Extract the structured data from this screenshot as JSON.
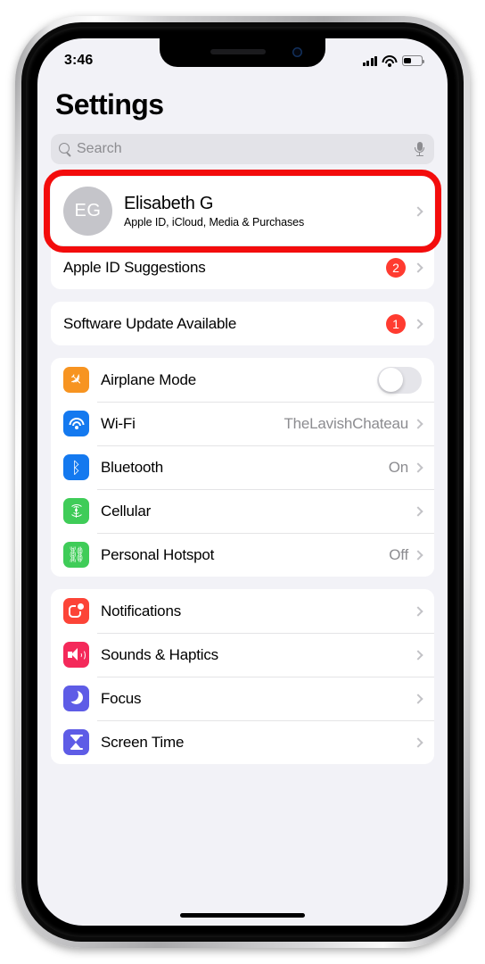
{
  "status_bar": {
    "time": "3:46",
    "signal_icon": "cellular-bars-icon",
    "wifi_icon": "wifi-icon",
    "battery_icon": "battery-icon",
    "battery_level_percent": 35
  },
  "header": {
    "title": "Settings"
  },
  "search": {
    "placeholder": "Search",
    "search_icon": "search-icon",
    "dictation_icon": "microphone-icon"
  },
  "apple_id": {
    "avatar_initials": "EG",
    "name": "Elisabeth G",
    "subtitle": "Apple ID, iCloud, Media & Purchases",
    "highlighted": true,
    "highlight_color": "#f30c0c"
  },
  "groups": [
    {
      "id": "account-group",
      "rows": [
        {
          "name": "apple-id-suggestions",
          "label": "Apple ID Suggestions",
          "badge": "2",
          "accessory": "chevron"
        }
      ]
    },
    {
      "id": "update-group",
      "rows": [
        {
          "name": "software-update-available",
          "label": "Software Update Available",
          "badge": "1",
          "accessory": "chevron"
        }
      ]
    },
    {
      "id": "connectivity-group",
      "rows": [
        {
          "name": "airplane-mode",
          "label": "Airplane Mode",
          "icon": "airplane-icon",
          "icon_color": "#f79421",
          "accessory": "toggle",
          "toggle_on": false
        },
        {
          "name": "wifi",
          "label": "Wi-Fi",
          "icon": "wifi-icon",
          "icon_color": "#1479ef",
          "value": "TheLavishChateau",
          "accessory": "chevron"
        },
        {
          "name": "bluetooth",
          "label": "Bluetooth",
          "icon": "bluetooth-icon",
          "icon_color": "#1479ef",
          "value": "On",
          "accessory": "chevron"
        },
        {
          "name": "cellular",
          "label": "Cellular",
          "icon": "cellular-antenna-icon",
          "icon_color": "#3fcc58",
          "value": "",
          "accessory": "chevron"
        },
        {
          "name": "personal-hotspot",
          "label": "Personal Hotspot",
          "icon": "hotspot-link-icon",
          "icon_color": "#3fcc58",
          "value": "Off",
          "accessory": "chevron"
        }
      ]
    },
    {
      "id": "system-group",
      "rows": [
        {
          "name": "notifications",
          "label": "Notifications",
          "icon": "notification-icon",
          "icon_color": "#fc4437",
          "value": "",
          "accessory": "chevron"
        },
        {
          "name": "sounds-haptics",
          "label": "Sounds & Haptics",
          "icon": "speaker-icon",
          "icon_color": "#f4295a",
          "value": "",
          "accessory": "chevron"
        },
        {
          "name": "focus",
          "label": "Focus",
          "icon": "moon-icon",
          "icon_color": "#5e5ce6",
          "value": "",
          "accessory": "chevron"
        },
        {
          "name": "screen-time",
          "label": "Screen Time",
          "icon": "hourglass-icon",
          "icon_color": "#5e5ce6",
          "value": "",
          "accessory": "chevron"
        }
      ]
    }
  ]
}
